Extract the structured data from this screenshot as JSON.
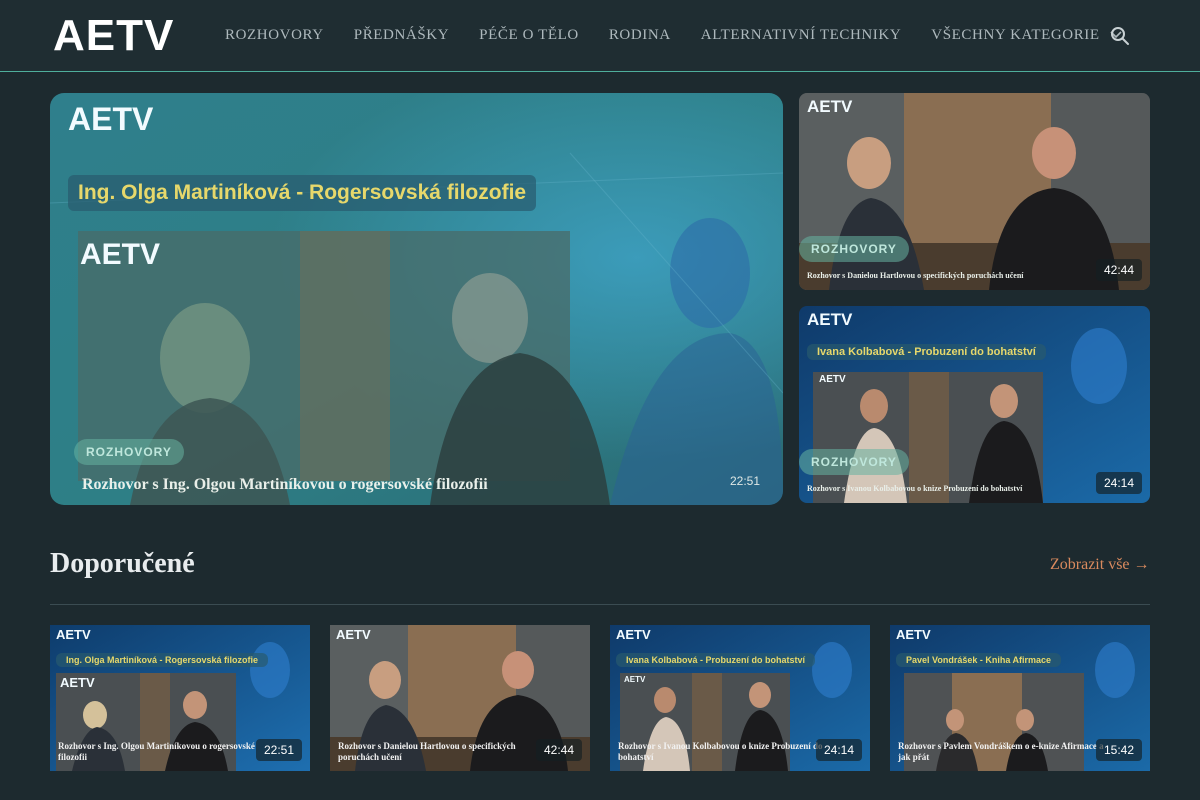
{
  "brand": {
    "logo": "AETV",
    "accent": "#4fae9c"
  },
  "nav": {
    "items": [
      "ROZHOVORY",
      "PŘEDNÁŠKY",
      "PÉČE O TĚLO",
      "RODINA",
      "ALTERNATIVNÍ TECHNIKY",
      "VŠECHNY KATEGORIE"
    ],
    "dropdown_icon": "chevron-down-icon",
    "search_icon": "search-icon"
  },
  "hero": {
    "main": {
      "thumb_logo": "AETV",
      "thumb_banner": "Ing. Olga Martiníková - Rogersovská filozofie",
      "thumb_logo_2": "AETV",
      "category": "ROZHOVORY",
      "title": "Rozhovor s Ing. Olgou Martiníkovou o rogersovské filozofii",
      "duration": "22:51"
    },
    "side": [
      {
        "thumb_logo": "AETV",
        "category": "ROZHOVORY",
        "title": "Rozhovor s Danielou Hartlovou o specifických poruchách učení",
        "duration": "42:44"
      },
      {
        "thumb_logo": "AETV",
        "thumb_banner": "Ivana Kolbabová - Probuzení do bohatství",
        "thumb_logo_2": "AETV",
        "category": "ROZHOVORY",
        "title": "Rozhovor s Ivanou Kolbabovou o knize Probuzení do bohatství",
        "duration": "24:14"
      }
    ]
  },
  "recommended": {
    "heading": "Doporučené",
    "show_all": "Zobrazit vše →",
    "items": [
      {
        "thumb_logo": "AETV",
        "thumb_banner": "Ing. Olga Martiníková - Rogersovská filozofie",
        "thumb_logo_2": "AETV",
        "title": "Rozhovor s Ing. Olgou Martiníkovou o rogersovské filozofii",
        "duration": "22:51"
      },
      {
        "thumb_logo": "AETV",
        "title": "Rozhovor s Danielou Hartlovou o specifických poruchách učení",
        "duration": "42:44"
      },
      {
        "thumb_logo": "AETV",
        "thumb_banner": "Ivana Kolbabová - Probuzení do bohatství",
        "thumb_logo_2": "AETV",
        "title": "Rozhovor s Ivanou Kolbabovou o knize Probuzení do bohatství",
        "duration": "24:14"
      },
      {
        "thumb_logo": "AETV",
        "thumb_banner": "Pavel Vondrášek - Kniha Afirmace",
        "title": "Rozhovor s Pavlem Vondráškem o e-knize Afirmace a jak přát",
        "duration": "15:42"
      }
    ]
  }
}
